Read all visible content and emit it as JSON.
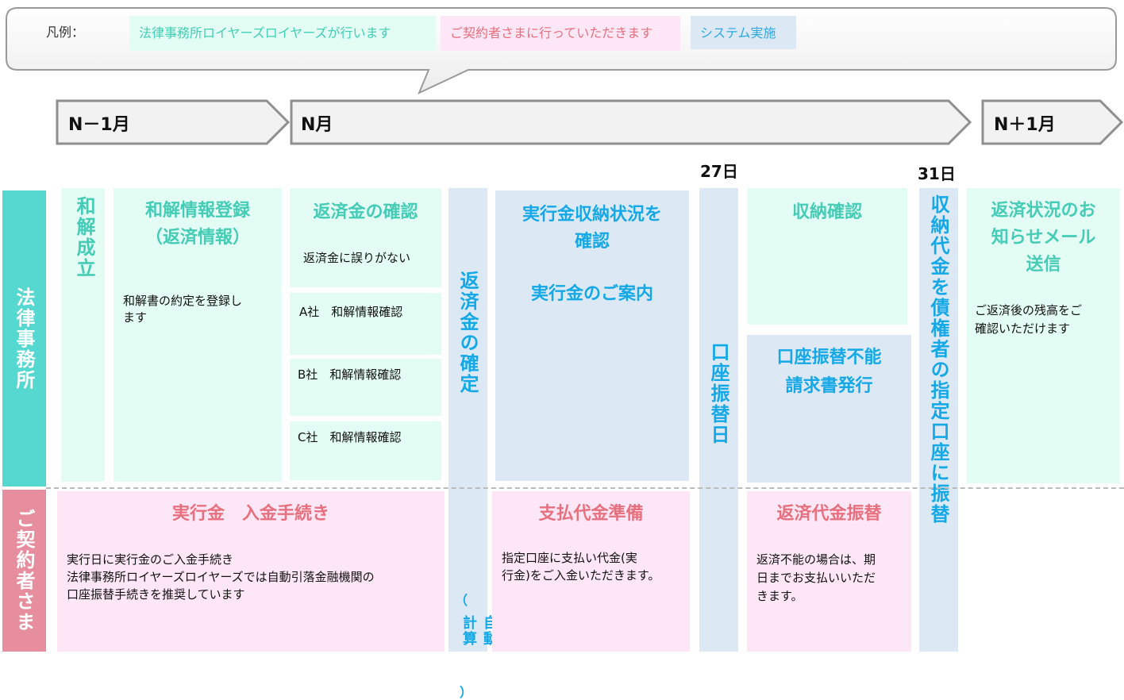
{
  "legend": {
    "title": "凡例：",
    "law_firm": "法律事務所ロイヤーズロイヤーズが行います",
    "customer": "ご契約者さまに行っていただきます",
    "system": "システム実施"
  },
  "timeline": {
    "prev_month": "N－1月",
    "month": "N月",
    "next_month": "N＋1月",
    "day27": "27日",
    "day31": "31日"
  },
  "rows": {
    "law_firm": "法律事務所",
    "customer": "ご契約者さま"
  },
  "law_steps": {
    "settlement": "和解成立",
    "register_title_1": "和解情報登録",
    "register_title_2": "（返済情報）",
    "register_desc_1": "和解書の約定を登録し",
    "register_desc_2": "ます",
    "confirm_title": "返済金の確認",
    "confirm_desc": "返済金に誤りがない",
    "company_a": "A社　和解情報確認",
    "company_b": "B社　和解情報確認",
    "company_c": "C社　和解情報確認",
    "check_title_1": "実行金収納状況を",
    "check_title_2": "確認",
    "guide_title": "実行金のご案内",
    "receipt_check": "収納確認",
    "fail_title_1": "口座振替不能",
    "fail_title_2": "請求書発行",
    "mail_title_1": "返済状況のお",
    "mail_title_2": "知らせメール",
    "mail_title_3": "送信",
    "mail_desc_1": "ご返済後の残高をご",
    "mail_desc_2": "確認いただけます"
  },
  "system_steps": {
    "determine_main": "返済金の確定",
    "determine_paren_open": "（",
    "determine_sub": "自動計算",
    "determine_paren_close": "）",
    "transfer_day": "口座振替日",
    "transfer_to": "収納代金を債権者の指定口座に振替"
  },
  "customer_steps": {
    "deposit_title": "実行金　入金手続き",
    "deposit_desc_1": "実行日に実行金のご入金手続き",
    "deposit_desc_2": "法律事務所ロイヤーズロイヤーズでは自動引落金融機関の",
    "deposit_desc_3": "口座振替手続きを推奨しています",
    "prepare_title": "支払代金準備",
    "prepare_desc_1": "指定口座に支払い代金(実",
    "prepare_desc_2": "行金)をご入金いただきます。",
    "transfer_title": "返済代金振替",
    "transfer_desc_1": "返済不能の場合は、期",
    "transfer_desc_2": "日までお支払いいただ",
    "transfer_desc_3": "きます。"
  },
  "colors": {
    "law_bg": "#e3fcf4",
    "law_text": "#45ccb6",
    "customer_bg": "#fde6f5",
    "customer_text": "#e8707e",
    "system_bg": "#dde8f5",
    "system_text": "#14a9e6",
    "law_header": "#55d8cf",
    "customer_header": "#e68e9e"
  }
}
